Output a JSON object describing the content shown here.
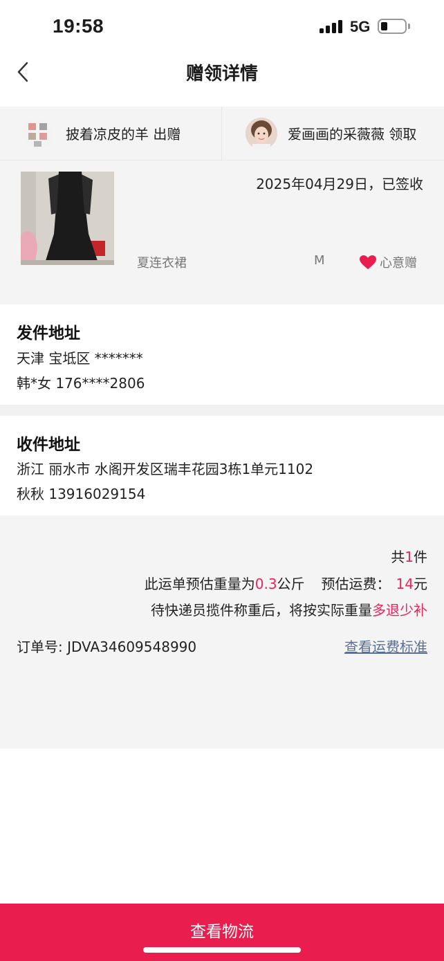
{
  "status_bar": {
    "time": "19:58",
    "network": "5G"
  },
  "nav": {
    "title": "赠领详情"
  },
  "parties": {
    "giver": {
      "name": "披着凉皮的羊",
      "action": "出赠"
    },
    "receiver": {
      "name": "爱画画的采薇薇",
      "action": "领取"
    }
  },
  "item": {
    "date_status": "2025年04月29日，已签收",
    "name": "夏连衣裙",
    "size": "M",
    "tag": "心意赠"
  },
  "sender_address": {
    "title": "发件地址",
    "line1": "天津 宝坻区 *******",
    "line2": "韩*女 176****2806"
  },
  "receiver_address": {
    "title": "收件地址",
    "line1": "浙江 丽水市 水阁开发区瑞丰花园3栋1单元1102",
    "line2": "秋秋 13916029154"
  },
  "summary": {
    "count_prefix": "共",
    "count": "1",
    "count_suffix": "件",
    "weight_prefix": "此运单预估重量为",
    "weight": "0.3",
    "weight_unit": "公斤",
    "fee_label": "预估运费：",
    "fee": "14",
    "fee_unit": "元",
    "note_prefix": "待快递员揽件称重后，将按实际重量",
    "note_highlight": "多退少补",
    "order_label": "订单号:",
    "order_number": "JDVA34609548990",
    "fee_standard_link": "查看运费标准"
  },
  "bottom": {
    "button": "查看物流"
  },
  "colors": {
    "accent": "#e91e4f",
    "highlight": "#e6265a",
    "link": "#5b6f96",
    "gray_bg": "#f4f4f4"
  }
}
